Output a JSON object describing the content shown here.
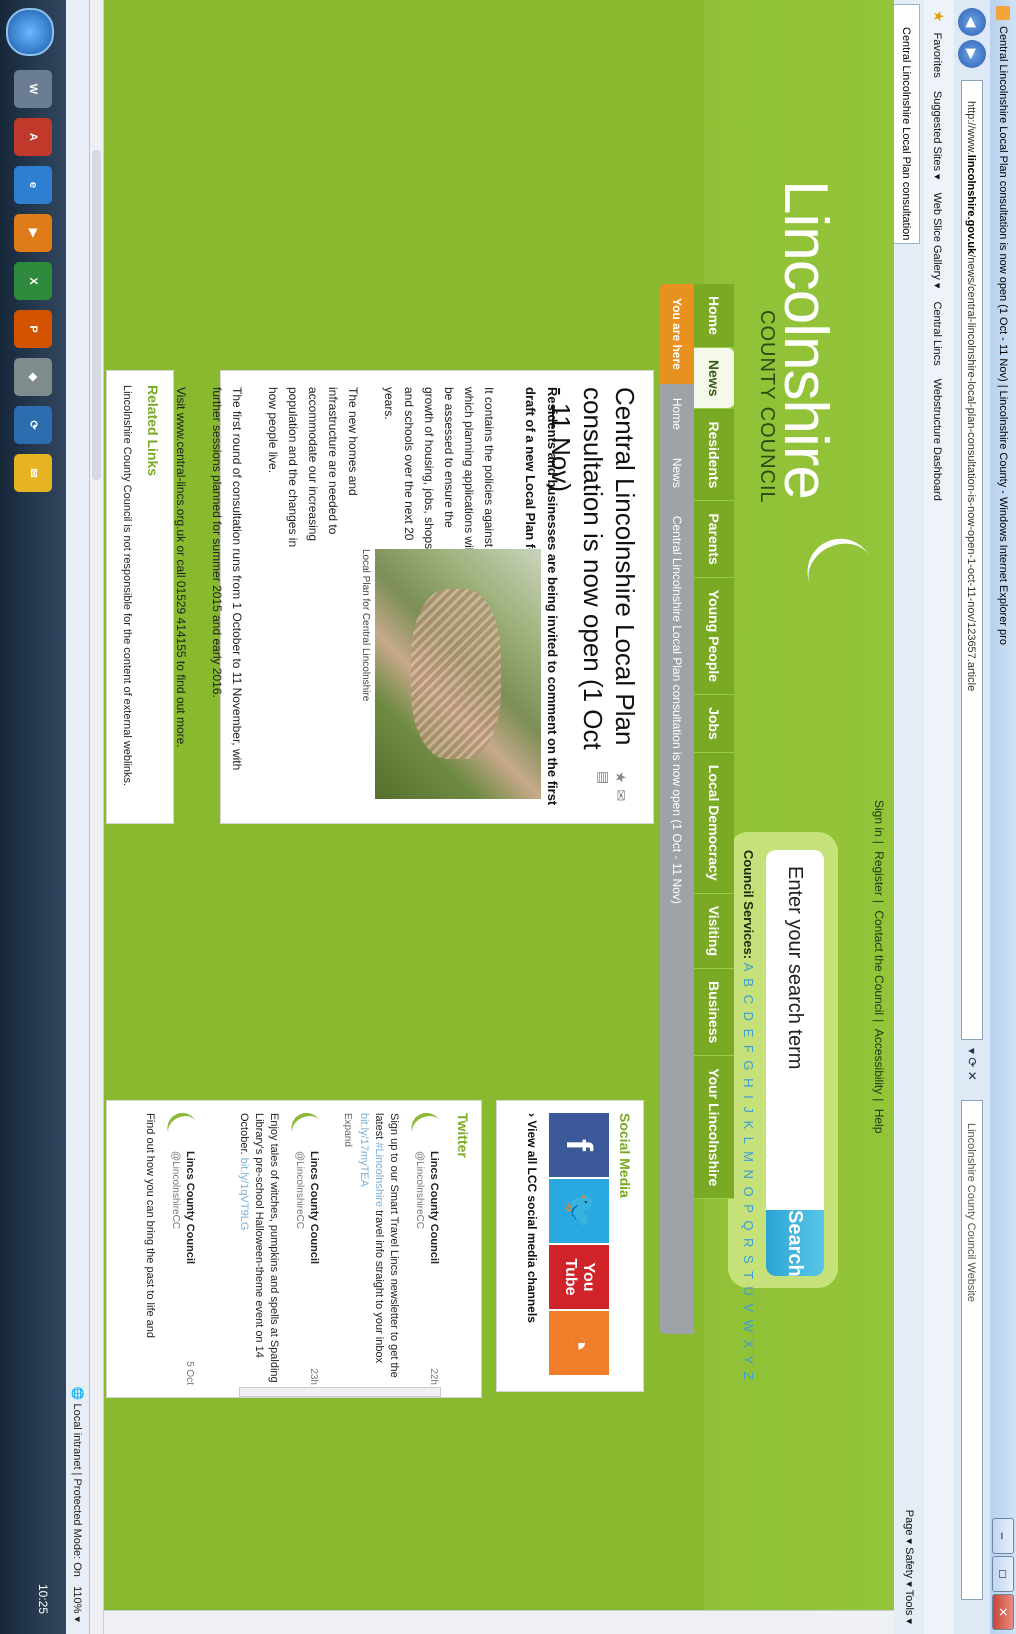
{
  "browser": {
    "title": "Central Lincolnshire Local Plan consultation is now open (1 Oct - 11 Nov) | Lincolnshire County - Windows Internet Explorer pro",
    "url_prefix": "http://www.",
    "url_domain": "lincolnshire.gov.uk",
    "url_path": "/news/central-lincolnshire-local-plan-consultation-is-now-open-1-oct-11-nov/123657.article",
    "search_placeholder": "Lincolnshire County Council Website",
    "favorites_label": "Favorites",
    "suggested_sites": "Suggested Sites ▾",
    "web_slice": "Web Slice Gallery ▾",
    "central_lincs": "Central Lincs",
    "webstructure": "Webstructure Dashboard",
    "tab_label": "Central Lincolnshire Local Plan consultation is no...",
    "tools_menu": "Page ▾   Safety ▾   Tools ▾",
    "status_zone": "Local intranet | Protected Mode: On",
    "zoom": "110%",
    "clock_time": "10:25"
  },
  "site": {
    "logo_name": "Lincolnshire",
    "logo_sub": "COUNTY COUNCIL",
    "top_links": [
      "Sign in",
      "Register",
      "Contact the Council",
      "Accessibility",
      "Help"
    ],
    "search_placeholder": "Enter your search term",
    "search_button": "Search",
    "council_services_label": "Council Services:",
    "az": "A B C D E F G H I J K L M N O P Q R S T U V W X Y Z"
  },
  "nav": {
    "items": [
      "Home",
      "News",
      "Residents",
      "Parents",
      "Young People",
      "Jobs",
      "Local Democracy",
      "Visiting",
      "Business",
      "Your Lincolnshire"
    ]
  },
  "breadcrumb": {
    "here": "You are here",
    "items": [
      "Home",
      "News",
      "Central Lincolnshire Local Plan consultation is now open (1 Oct - 11 Nov)"
    ]
  },
  "article": {
    "title": "Central Lincolnshire Local Plan consultation is now open (1 Oct - 11 Nov)",
    "lead": "Residents and businesses are being invited to comment on the first draft of a new Local Plan for Central Lincolnshire.",
    "p1": "It contains the policies against which planning applications will be assessed to ensure the growth of housing, jobs, shops and schools over the next 20 years.",
    "p2": "The new homes and infrastructure are needed to accommodate our increasing population and the changes in how people live.",
    "p3": "The first round of consultation runs from 1 October to 11 November, with further sessions planned for summer 2015 and early 2016.",
    "p4": "Visit www.central-lincs.org.uk or call 01529 414155 to find out more.",
    "photo_caption": "Local Plan for Central Lincolnshire"
  },
  "related": {
    "heading": "Related Links",
    "text": "Lincolnshire County Council is not responsible for the content of external weblinks."
  },
  "social": {
    "heading": "Social Media",
    "link": "View all LCC social media channels"
  },
  "twitter": {
    "heading": "Twitter",
    "tweets": [
      {
        "name": "Lincs County Council",
        "handle": "@LincolnshireCC",
        "time": "22h",
        "pre": "Sign up to our Smart Travel Lincs newsletter to get the latest ",
        "hashtag": "#Lincolnshire",
        "post": " travel info straight to your inbox ",
        "link": "bit.ly/17myTEA",
        "expand": "Expand"
      },
      {
        "name": "Lincs County Council",
        "handle": "@LincolnshireCC",
        "time": "23h",
        "pre": "Enjoy tales of witches, pumpkins and spells at Spalding Library's pre-school Halloween-theme event on 14 October. ",
        "hashtag": "",
        "post": "",
        "link": "bit.ly/1qVT9LG",
        "expand": ""
      },
      {
        "name": "Lincs County Council",
        "handle": "@LincolnshireCC",
        "time": "5 Oct",
        "pre": "Find out how you can bring the past to life and",
        "hashtag": "",
        "post": "",
        "link": "",
        "expand": ""
      }
    ]
  },
  "colors": {
    "brand_green": "#88b92e",
    "search_blue": "#2aa4d4",
    "breadcrumb_orange": "#e8911e"
  }
}
